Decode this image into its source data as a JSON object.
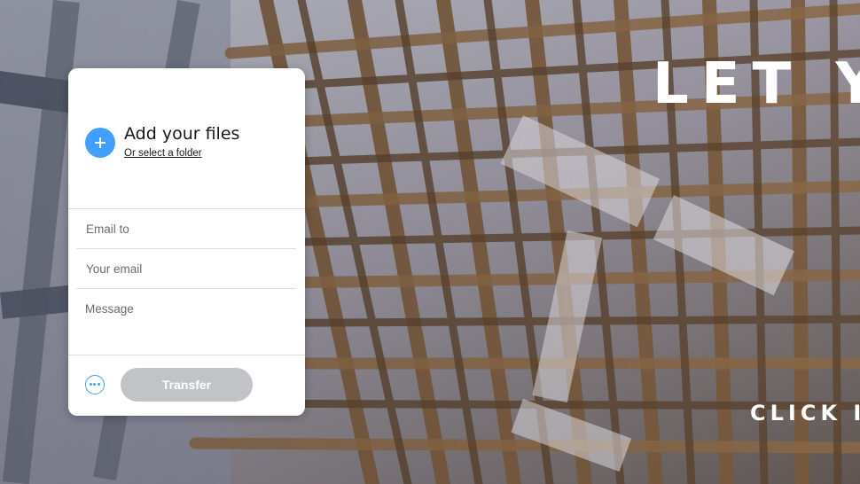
{
  "hero": {
    "title": "LET YO",
    "cta": "CLICK I"
  },
  "upload": {
    "add_icon": "plus-icon",
    "title": "Add your files",
    "folder_link": "Or select a folder"
  },
  "form": {
    "email_to_placeholder": "Email to",
    "your_email_placeholder": "Your email",
    "message_placeholder": "Message"
  },
  "footer": {
    "more_icon": "more-options-icon",
    "transfer_label": "Transfer"
  },
  "colors": {
    "accent": "#409fff",
    "button_disabled": "#c2c3c6",
    "panel_bg": "#ffffff"
  }
}
